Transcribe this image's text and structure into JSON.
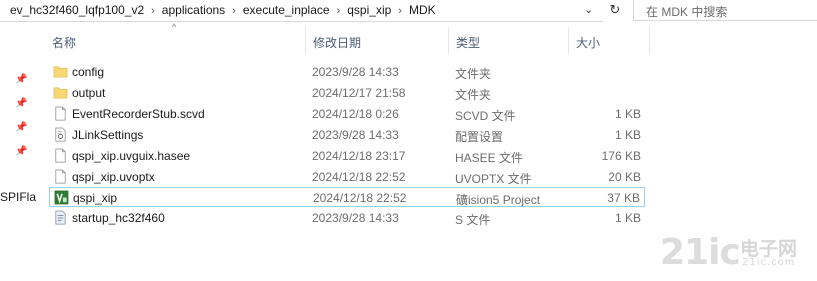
{
  "breadcrumb": [
    "ev_hc32f460_lqfp100_v2",
    "applications",
    "execute_inplace",
    "qspi_xip",
    "MDK"
  ],
  "search": {
    "placeholder": "在 MDK 中搜索"
  },
  "left_pane": {
    "fragment": "SPIFla"
  },
  "columns": {
    "name": "名称",
    "date": "修改日期",
    "type": "类型",
    "size": "大小"
  },
  "files": [
    {
      "name": "config",
      "date": "2023/9/28 14:33",
      "type": "文件夹",
      "size": "",
      "icon": "folder-icon"
    },
    {
      "name": "output",
      "date": "2024/12/17 21:58",
      "type": "文件夹",
      "size": "",
      "icon": "folder-icon"
    },
    {
      "name": "EventRecorderStub.scvd",
      "date": "2024/12/18 0:26",
      "type": "SCVD 文件",
      "size": "1 KB",
      "icon": "file-icon"
    },
    {
      "name": "JLinkSettings",
      "date": "2023/9/28 14:33",
      "type": "配置设置",
      "size": "1 KB",
      "icon": "settings-file-icon"
    },
    {
      "name": "qspi_xip.uvguix.hasee",
      "date": "2024/12/18 23:17",
      "type": "HASEE 文件",
      "size": "176 KB",
      "icon": "file-icon"
    },
    {
      "name": "qspi_xip.uvoptx",
      "date": "2024/12/18 22:52",
      "type": "UVOPTX 文件",
      "size": "20 KB",
      "icon": "file-icon"
    },
    {
      "name": "qspi_xip",
      "date": "2024/12/18 22:52",
      "type": "礦ision5 Project",
      "size": "37 KB",
      "icon": "keil-project-icon",
      "selected": true
    },
    {
      "name": "startup_hc32f460",
      "date": "2023/9/28 14:33",
      "type": "S 文件",
      "size": "1 KB",
      "icon": "asm-file-icon"
    }
  ],
  "watermark": {
    "number": "21ic",
    "cn": "电子网",
    "en": "21ic.com"
  },
  "colors": {
    "folder": "#f8d775",
    "header_text": "#4c607a",
    "selection_border": "#99d1ff",
    "keil_green": "#2e7d32"
  }
}
